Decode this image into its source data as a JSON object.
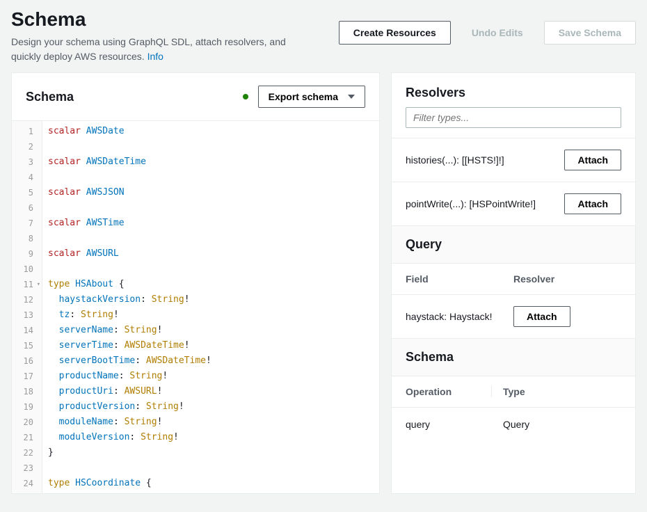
{
  "header": {
    "title": "Schema",
    "subtitle_pre": "Design your schema using GraphQL SDL, attach resolvers, and quickly deploy AWS resources. ",
    "info_link": "Info",
    "create_btn": "Create Resources",
    "undo_btn": "Undo Edits",
    "save_btn": "Save Schema"
  },
  "schema_panel": {
    "title": "Schema",
    "export_btn": "Export schema",
    "code_lines": [
      [
        [
          "tok-scalar",
          "scalar"
        ],
        [
          "sp",
          " "
        ],
        [
          "tok-type",
          "AWSDate"
        ]
      ],
      [],
      [
        [
          "tok-scalar",
          "scalar"
        ],
        [
          "sp",
          " "
        ],
        [
          "tok-type",
          "AWSDateTime"
        ]
      ],
      [],
      [
        [
          "tok-scalar",
          "scalar"
        ],
        [
          "sp",
          " "
        ],
        [
          "tok-type",
          "AWSJSON"
        ]
      ],
      [],
      [
        [
          "tok-scalar",
          "scalar"
        ],
        [
          "sp",
          " "
        ],
        [
          "tok-type",
          "AWSTime"
        ]
      ],
      [],
      [
        [
          "tok-scalar",
          "scalar"
        ],
        [
          "sp",
          " "
        ],
        [
          "tok-type",
          "AWSURL"
        ]
      ],
      [],
      [
        [
          "tok-kw",
          "type"
        ],
        [
          "sp",
          " "
        ],
        [
          "tok-type",
          "HSAbout"
        ],
        [
          "sp",
          " "
        ],
        [
          "tok-brace",
          "{"
        ]
      ],
      [
        [
          "sp",
          "  "
        ],
        [
          "tok-field",
          "haystackVersion"
        ],
        [
          "tok-punc",
          ": "
        ],
        [
          "tok-str",
          "String"
        ],
        [
          "tok-punc",
          "!"
        ]
      ],
      [
        [
          "sp",
          "  "
        ],
        [
          "tok-field",
          "tz"
        ],
        [
          "tok-punc",
          ": "
        ],
        [
          "tok-str",
          "String"
        ],
        [
          "tok-punc",
          "!"
        ]
      ],
      [
        [
          "sp",
          "  "
        ],
        [
          "tok-field",
          "serverName"
        ],
        [
          "tok-punc",
          ": "
        ],
        [
          "tok-str",
          "String"
        ],
        [
          "tok-punc",
          "!"
        ]
      ],
      [
        [
          "sp",
          "  "
        ],
        [
          "tok-field",
          "serverTime"
        ],
        [
          "tok-punc",
          ": "
        ],
        [
          "tok-str",
          "AWSDateTime"
        ],
        [
          "tok-punc",
          "!"
        ]
      ],
      [
        [
          "sp",
          "  "
        ],
        [
          "tok-field",
          "serverBootTime"
        ],
        [
          "tok-punc",
          ": "
        ],
        [
          "tok-str",
          "AWSDateTime"
        ],
        [
          "tok-punc",
          "!"
        ]
      ],
      [
        [
          "sp",
          "  "
        ],
        [
          "tok-field",
          "productName"
        ],
        [
          "tok-punc",
          ": "
        ],
        [
          "tok-str",
          "String"
        ],
        [
          "tok-punc",
          "!"
        ]
      ],
      [
        [
          "sp",
          "  "
        ],
        [
          "tok-field",
          "productUri"
        ],
        [
          "tok-punc",
          ": "
        ],
        [
          "tok-str",
          "AWSURL"
        ],
        [
          "tok-punc",
          "!"
        ]
      ],
      [
        [
          "sp",
          "  "
        ],
        [
          "tok-field",
          "productVersion"
        ],
        [
          "tok-punc",
          ": "
        ],
        [
          "tok-str",
          "String"
        ],
        [
          "tok-punc",
          "!"
        ]
      ],
      [
        [
          "sp",
          "  "
        ],
        [
          "tok-field",
          "moduleName"
        ],
        [
          "tok-punc",
          ": "
        ],
        [
          "tok-str",
          "String"
        ],
        [
          "tok-punc",
          "!"
        ]
      ],
      [
        [
          "sp",
          "  "
        ],
        [
          "tok-field",
          "moduleVersion"
        ],
        [
          "tok-punc",
          ": "
        ],
        [
          "tok-str",
          "String"
        ],
        [
          "tok-punc",
          "!"
        ]
      ],
      [
        [
          "tok-brace",
          "}"
        ]
      ],
      [],
      [
        [
          "tok-kw",
          "type"
        ],
        [
          "sp",
          " "
        ],
        [
          "tok-type",
          "HSCoordinate"
        ],
        [
          "sp",
          " "
        ],
        [
          "tok-brace",
          "{"
        ]
      ]
    ]
  },
  "resolvers_panel": {
    "title": "Resolvers",
    "filter_placeholder": "Filter types...",
    "rows": [
      {
        "sig": "histories(...): [[HSTS!]!]",
        "btn": "Attach"
      },
      {
        "sig": "pointWrite(...): [HSPointWrite!]",
        "btn": "Attach"
      }
    ],
    "query_section": {
      "title": "Query",
      "head_field": "Field",
      "head_resolver": "Resolver",
      "rows": [
        {
          "sig": "haystack: Haystack!",
          "btn": "Attach"
        }
      ]
    },
    "schema_section": {
      "title": "Schema",
      "head_op": "Operation",
      "head_type": "Type",
      "rows": [
        {
          "op": "query",
          "type": "Query"
        }
      ]
    }
  }
}
